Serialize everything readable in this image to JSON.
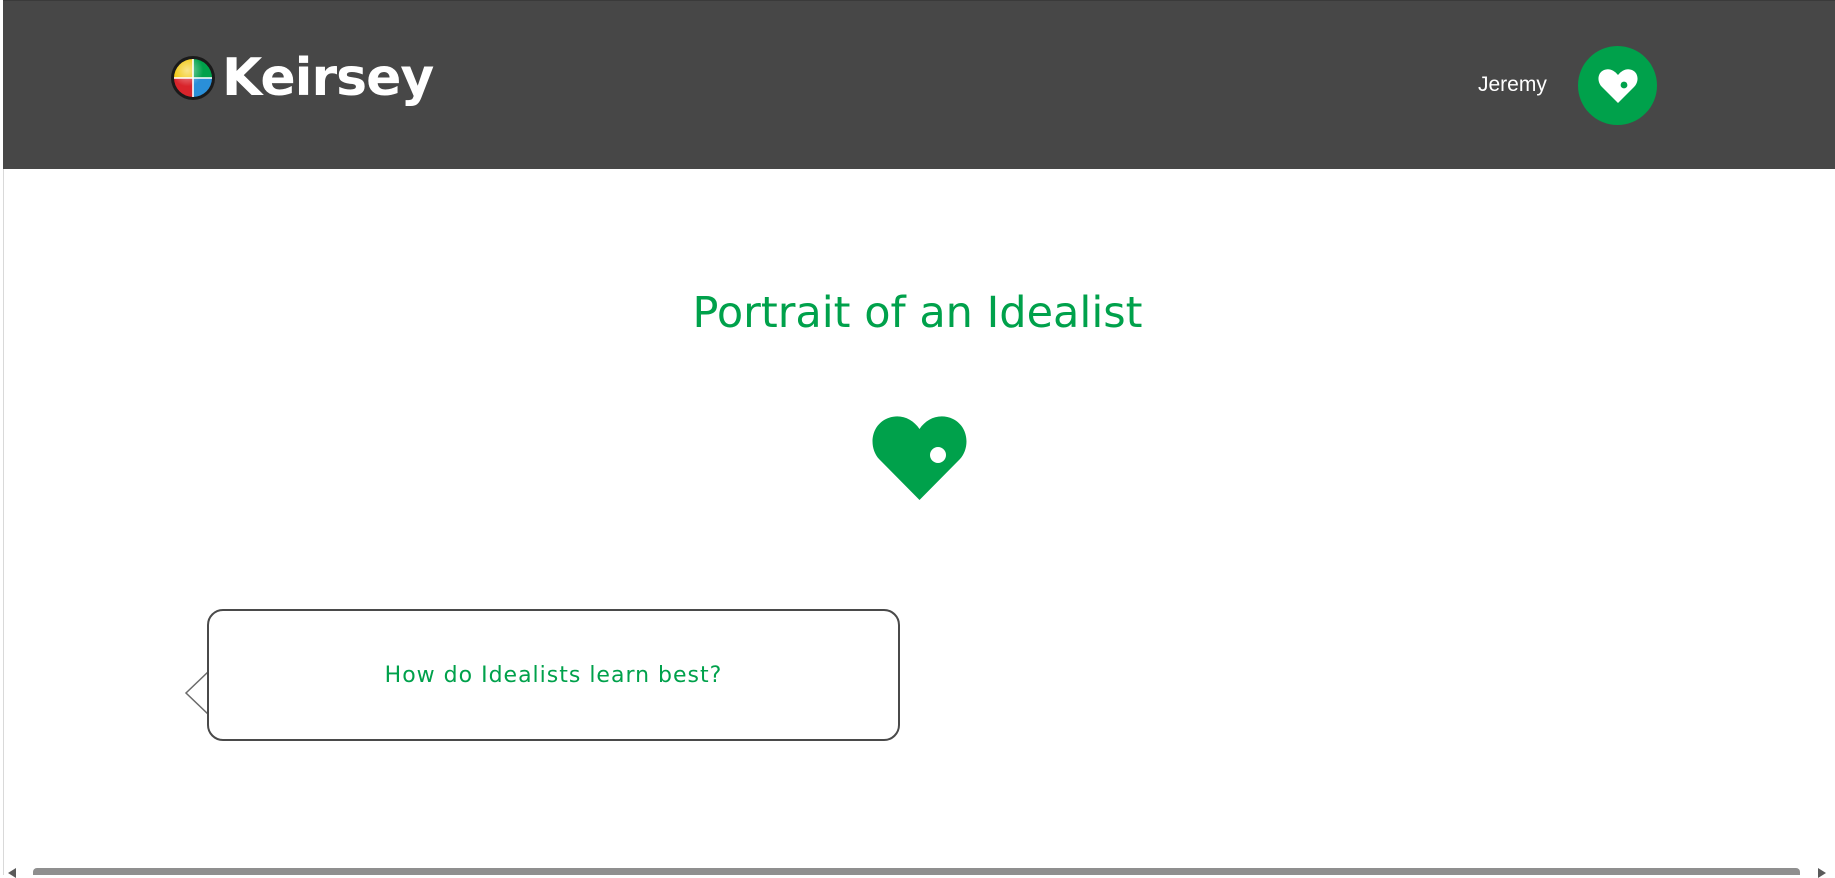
{
  "header": {
    "brand_name": "Keirsey",
    "brand_icon": "temperament-quadrant-icon",
    "user_name": "Jeremy",
    "type_badge_icon": "idealist-heart-icon"
  },
  "main": {
    "title": "Portrait of an Idealist",
    "hero_icon": "idealist-heart-icon",
    "question_bubble": {
      "text": "How do Idealists learn best?"
    }
  },
  "colors": {
    "header_background": "#474747",
    "accent_green": "#00a14b",
    "bubble_border": "#4a4a4a",
    "scrollbar_thumb": "#8f8f8f"
  }
}
